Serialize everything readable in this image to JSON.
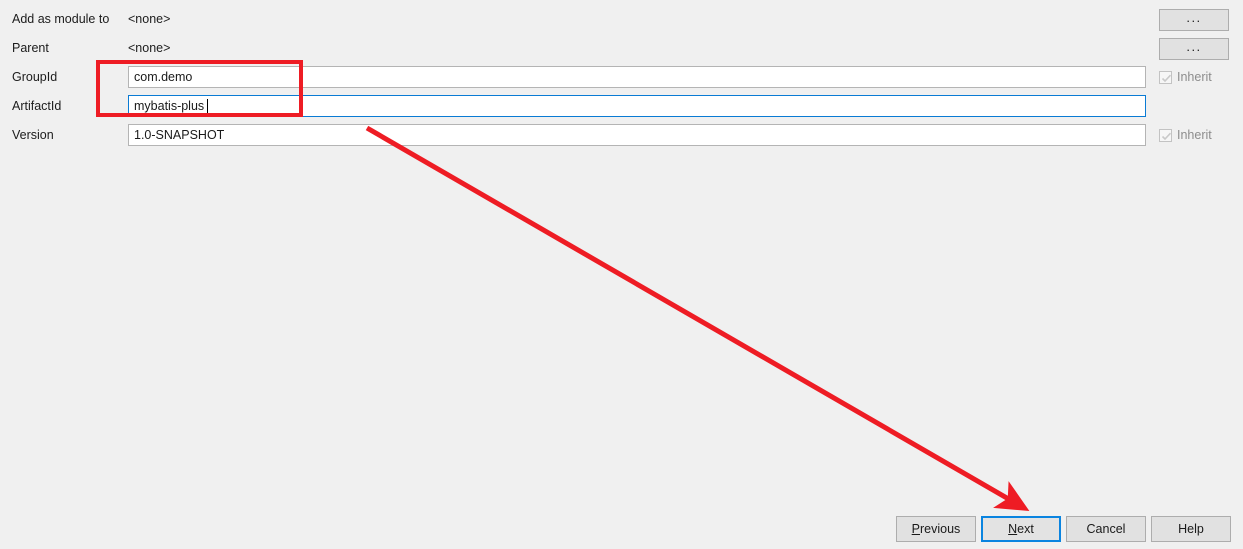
{
  "dialog": {
    "rows": [
      {
        "label": "Add as module to",
        "value": "<none>",
        "type": "static",
        "browse": "..."
      },
      {
        "label": "Parent",
        "value": "<none>",
        "type": "static",
        "browse": "..."
      },
      {
        "label": "GroupId",
        "value": "com.demo",
        "type": "input",
        "inherit": "Inherit"
      },
      {
        "label": "ArtifactId",
        "value": "mybatis-plus",
        "type": "input"
      },
      {
        "label": "Version",
        "value": "1.0-SNAPSHOT",
        "type": "input",
        "inherit": "Inherit"
      }
    ]
  },
  "buttons": {
    "previous": {
      "label": "Previous",
      "mnemonic": "P"
    },
    "next": {
      "label": "Next",
      "mnemonic": "N"
    },
    "cancel": {
      "label": "Cancel"
    },
    "help": {
      "label": "Help"
    }
  },
  "colors": {
    "background": "#f0f0f0",
    "annotation_red": "#ee1c24",
    "focus_blue": "#0a84e0",
    "field_border": "#b4b4b4",
    "field_focus_border": "#0a7bd4",
    "button_face": "#e1e1e1",
    "disabled_text": "#8d8d8d"
  },
  "annotations": {
    "highlight_rect": "red-rectangle-around-groupid-artifactid",
    "arrow": "red-arrow-pointing-to-next-button"
  }
}
